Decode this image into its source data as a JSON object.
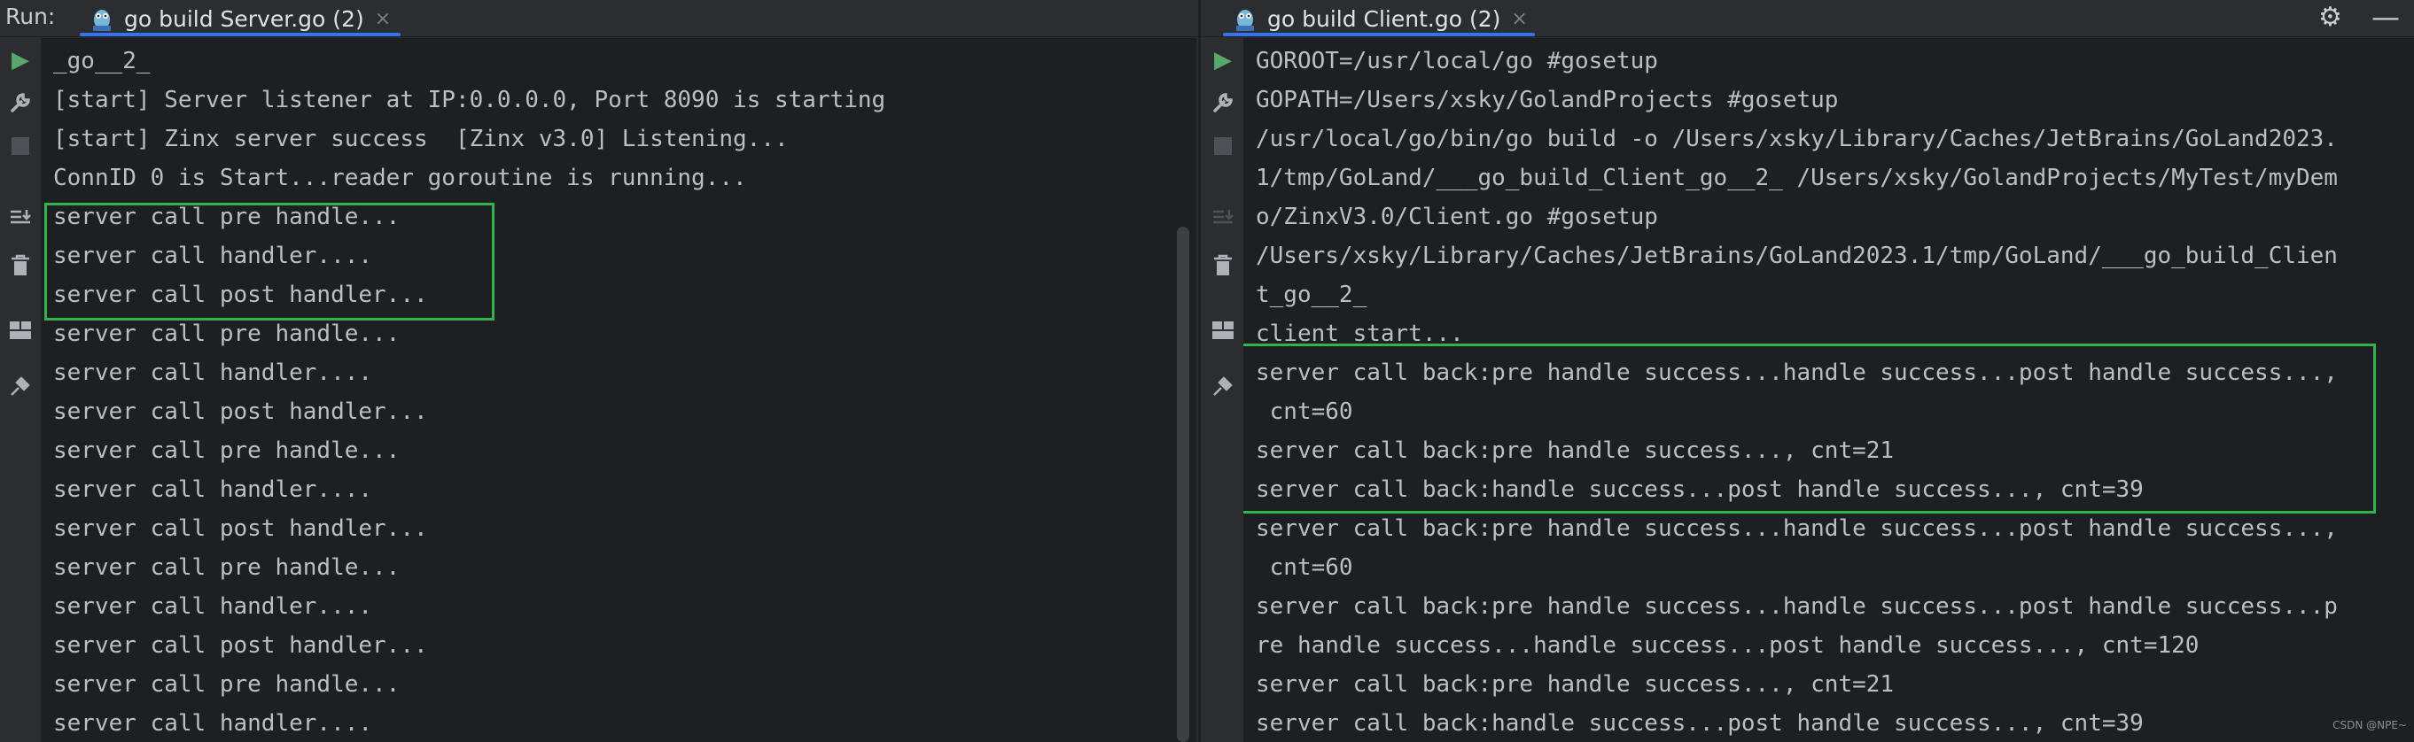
{
  "run_label": "Run:",
  "tabs": [
    {
      "label": "go build Server.go (2)",
      "close": "×"
    },
    {
      "label": "go build Client.go (2)",
      "close": "×"
    }
  ],
  "toolbar": {
    "settings_icon": "gear-icon",
    "minimize_icon": "minimize-icon"
  },
  "gutter_icons": [
    "rerun-icon",
    "wrench-icon",
    "stop-icon",
    "scroll-to-end-icon",
    "trash-icon",
    "layout-icon",
    "pin-icon"
  ],
  "server_console": {
    "lines": [
      "_go__2_",
      "[start] Server listener at IP:0.0.0.0, Port 8090 is starting",
      "[start] Zinx server success  [Zinx v3.0] Listening...",
      "ConnID 0 is Start...reader goroutine is running...",
      "server call pre handle...",
      "server call handler....",
      "server call post handler...",
      "server call pre handle...",
      "server call handler....",
      "server call post handler...",
      "server call pre handle...",
      "server call handler....",
      "server call post handler...",
      "server call pre handle...",
      "server call handler....",
      "server call post handler...",
      "server call pre handle...",
      "server call handler...."
    ]
  },
  "client_console": {
    "lines": [
      "GOROOT=/usr/local/go #gosetup",
      "GOPATH=/Users/xsky/GolandProjects #gosetup",
      "/usr/local/go/bin/go build -o /Users/xsky/Library/Caches/JetBrains/GoLand2023.",
      "1/tmp/GoLand/___go_build_Client_go__2_ /Users/xsky/GolandProjects/MyTest/myDem",
      "o/ZinxV3.0/Client.go #gosetup",
      "/Users/xsky/Library/Caches/JetBrains/GoLand2023.1/tmp/GoLand/___go_build_Clien",
      "t_go__2_",
      "client start...",
      "server call back:pre handle success...handle success...post handle success...,",
      " cnt=60",
      "server call back:pre handle success..., cnt=21",
      "server call back:handle success...post handle success..., cnt=39",
      "server call back:pre handle success...handle success...post handle success...,",
      " cnt=60",
      "server call back:pre handle success...handle success...post handle success...p",
      "re handle success...handle success...post handle success..., cnt=120",
      "server call back:pre handle success..., cnt=21",
      "server call back:handle success...post handle success..., cnt=39"
    ]
  },
  "watermark": "CSDN @NPE~",
  "colors": {
    "highlight_box": "#2fb34a",
    "tab_underline": "#3574f0",
    "run_green": "#59a869"
  }
}
